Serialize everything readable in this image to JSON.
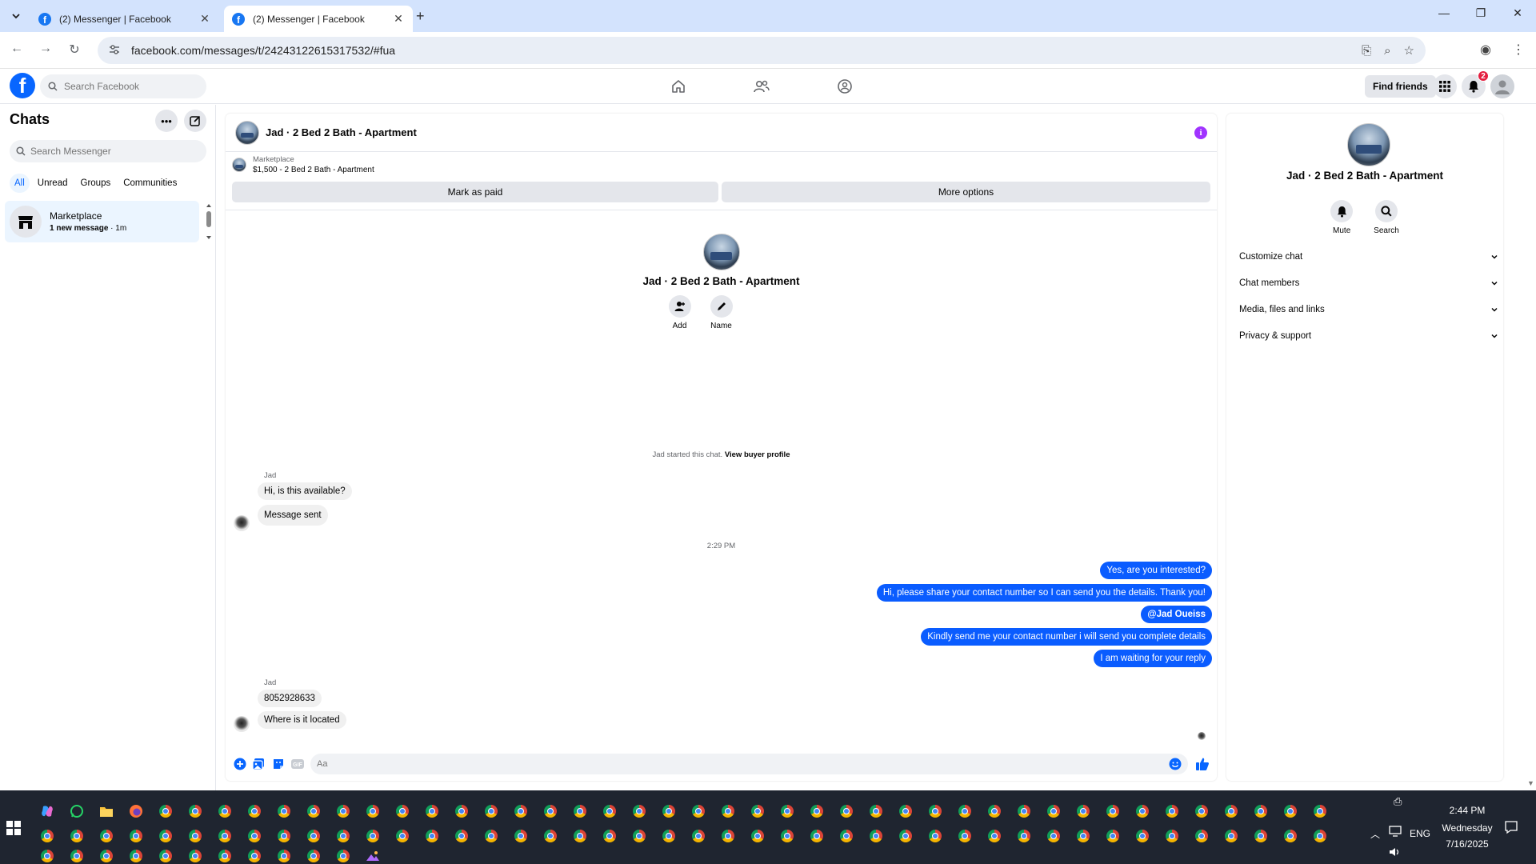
{
  "browser": {
    "tabs": [
      {
        "title": "(2) Messenger | Facebook",
        "active": false
      },
      {
        "title": "(2) Messenger | Facebook",
        "active": true
      }
    ],
    "new_tab_symbol": "+",
    "url": "facebook.com/messages/t/24243122615317532/#fua",
    "window_controls": {
      "minimize": "—",
      "restore": "❐",
      "close": "✕"
    }
  },
  "fb_header": {
    "logo": "f",
    "search_placeholder": "Search Facebook",
    "find_friends": "Find friends",
    "notification_count": "2"
  },
  "sidebar": {
    "title": "Chats",
    "search_placeholder": "Search Messenger",
    "filters": [
      "All",
      "Unread",
      "Groups",
      "Communities"
    ],
    "active_filter": "All",
    "chats": [
      {
        "name": "Marketplace",
        "preview": "1 new message",
        "time": "1m"
      }
    ]
  },
  "chat": {
    "title": "Jad · 2 Bed 2 Bath - Apartment",
    "marketplace_label": "Marketplace",
    "listing": "$1,500 - 2 Bed 2 Bath - Apartment",
    "mark_paid": "Mark as paid",
    "more_options": "More options",
    "intro_name": "Jad · 2 Bed 2 Bath - Apartment",
    "intro_add": "Add",
    "intro_name_btn": "Name",
    "system_text": "Jad started this chat.",
    "system_link": "View buyer profile",
    "sender_1": "Jad",
    "msg_in_1": "Hi, is this available?",
    "msg_in_2": "Message sent",
    "time_sep": "2:29 PM",
    "msg_out_1": "Yes, are you interested?",
    "msg_out_2": "Hi, please share your contact number so I can send you the details. Thank you!",
    "msg_out_3": "@Jad Oueiss",
    "msg_out_4": "Kindly send me your contact number i will send you complete details",
    "msg_out_5": "I am waiting for your reply",
    "sender_2": "Jad",
    "msg_in_3": "8052928633",
    "msg_in_4": "Where is it located",
    "composer_placeholder": "Aa"
  },
  "info_panel": {
    "name": "Jad · 2 Bed 2 Bath - Apartment",
    "mute": "Mute",
    "search": "Search",
    "sections": [
      "Customize chat",
      "Chat members",
      "Media, files and links",
      "Privacy & support"
    ]
  },
  "taskbar": {
    "time": "2:44 PM",
    "day": "Wednesday",
    "date": "7/16/2025",
    "lang": "ENG"
  },
  "colors": {
    "brand": "#0866ff",
    "outgoing_bubble": "#0a5cff",
    "info_icon": "#a033ff",
    "tab_strip": "#d3e3fd"
  }
}
